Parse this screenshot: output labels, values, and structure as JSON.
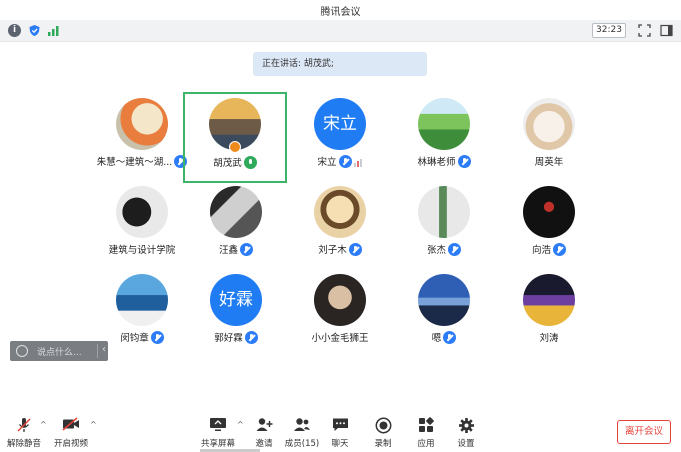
{
  "window": {
    "title": "腾讯会议"
  },
  "status": {
    "timer": "32:23"
  },
  "speaking": {
    "text": "正在讲话: 胡茂武;"
  },
  "participants": [
    {
      "name": "朱慧～建筑～湖...",
      "mic": "muted",
      "avatar": "photo"
    },
    {
      "name": "胡茂武",
      "mic": "speaking",
      "avatar": "photo",
      "host": true,
      "active": true
    },
    {
      "name": "宋立",
      "mic": "muted",
      "avatar": "text",
      "avatar_text": "宋立",
      "signal": true
    },
    {
      "name": "林琳老师",
      "mic": "muted",
      "avatar": "photo"
    },
    {
      "name": "周英年",
      "mic": "none",
      "avatar": "photo"
    },
    {
      "name": "建筑与设计学院",
      "mic": "none",
      "avatar": "photo"
    },
    {
      "name": "汪鑫",
      "mic": "muted",
      "avatar": "photo"
    },
    {
      "name": "刘子木",
      "mic": "muted",
      "avatar": "photo"
    },
    {
      "name": "张杰",
      "mic": "muted",
      "avatar": "photo"
    },
    {
      "name": "向浩",
      "mic": "muted",
      "avatar": "photo"
    },
    {
      "name": "闵钧章",
      "mic": "muted",
      "avatar": "photo"
    },
    {
      "name": "郭好霖",
      "mic": "muted",
      "avatar": "text",
      "avatar_text": "好霖"
    },
    {
      "name": "小小金毛狮王",
      "mic": "none",
      "avatar": "photo"
    },
    {
      "name": "嗯",
      "mic": "muted",
      "avatar": "photo"
    },
    {
      "name": "刘涛",
      "mic": "none",
      "avatar": "photo"
    }
  ],
  "chat": {
    "placeholder": "说点什么..."
  },
  "toolbar": {
    "unmute": "解除静音",
    "start_video": "开启视频",
    "share_screen": "共享屏幕",
    "invite": "邀请",
    "members": "成员(15)",
    "chat": "聊天",
    "record": "录制",
    "apps": "应用",
    "settings": "设置",
    "leave": "离开会议"
  },
  "colors": {
    "accent": "#2b7cf6",
    "speaking": "#2faa5a",
    "leave": "#e3443a",
    "active_border": "#3cb56b"
  }
}
